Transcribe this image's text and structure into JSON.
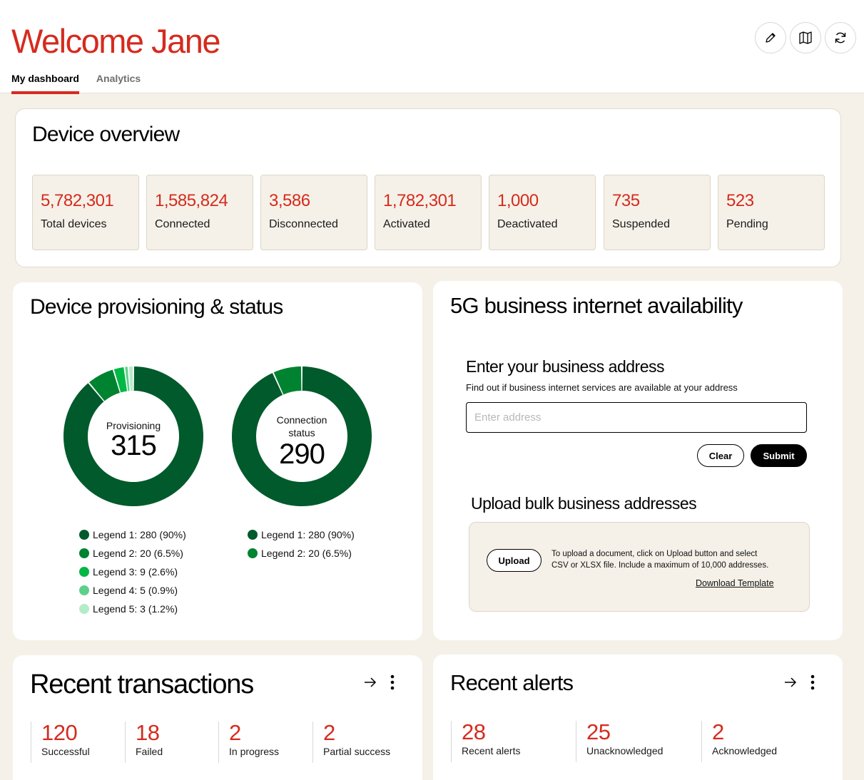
{
  "header": {
    "title": "Welcome Jane",
    "tabs": [
      {
        "label": "My dashboard",
        "active": true
      },
      {
        "label": "Analytics",
        "active": false
      }
    ],
    "icons": [
      "pencil-icon",
      "map-icon",
      "refresh-icon"
    ]
  },
  "device_overview": {
    "title": "Device overview",
    "stats": [
      {
        "value": "5,782,301",
        "label": "Total devices"
      },
      {
        "value": "1,585,824",
        "label": "Connected"
      },
      {
        "value": "3,586",
        "label": "Disconnected"
      },
      {
        "value": "1,782,301",
        "label": "Activated"
      },
      {
        "value": "1,000",
        "label": "Deactivated"
      },
      {
        "value": "735",
        "label": "Suspended"
      },
      {
        "value": "523",
        "label": "Pending"
      }
    ]
  },
  "provisioning": {
    "title": "Device provisioning & status",
    "donut1": {
      "center_label": "Provisioning",
      "center_value": "315",
      "segments": [
        {
          "label": "Legend 1: 280  (90%)",
          "value": 90,
          "color": "#005a2b"
        },
        {
          "label": "Legend 2: 20  (6.5%)",
          "value": 6.5,
          "color": "#008331"
        },
        {
          "label": "Legend 3: 9  (2.6%)",
          "value": 2.6,
          "color": "#00b845"
        },
        {
          "label": "Legend 4: 5  (0.9%)",
          "value": 0.9,
          "color": "#5cd08a"
        },
        {
          "label": "Legend 5: 3  (1.2%)",
          "value": 1.2,
          "color": "#b3ecc8"
        }
      ]
    },
    "donut2": {
      "center_label_line1": "Connection",
      "center_label_line2": "status",
      "center_value": "290",
      "segments": [
        {
          "label": "Legend 1: 280  (90%)",
          "value": 90,
          "color": "#005a2b"
        },
        {
          "label": "Legend 2: 20  (6.5%)",
          "value": 6.5,
          "color": "#008331"
        }
      ]
    }
  },
  "availability": {
    "title": "5G business internet availability",
    "address_heading": "Enter your business address",
    "address_sub": "Find out if business internet services are available at your address",
    "address_placeholder": "Enter address",
    "address_value": "",
    "clear_label": "Clear",
    "submit_label": "Submit",
    "bulk_heading": "Upload bulk business addresses",
    "upload_label": "Upload",
    "upload_text_1": "To upload a document, click on Upload button and select",
    "upload_text_2": "CSV or XLSX file. Include a maximum of 10,000 addresses.",
    "download_label": "Download Template"
  },
  "transactions": {
    "title": "Recent transactions",
    "metrics": [
      {
        "value": "120",
        "label": "Successful"
      },
      {
        "value": "18",
        "label": "Failed"
      },
      {
        "value": "2",
        "label": "In progress"
      },
      {
        "value": "2",
        "label": "Partial success"
      }
    ]
  },
  "alerts": {
    "title": "Recent alerts",
    "metrics": [
      {
        "value": "28",
        "label": "Recent alerts"
      },
      {
        "value": "25",
        "label": "Unacknowledged"
      },
      {
        "value": "2",
        "label": "Acknowledged"
      }
    ]
  },
  "colors": {
    "brand_red": "#d52b1e",
    "background": "#f5f1e8"
  }
}
